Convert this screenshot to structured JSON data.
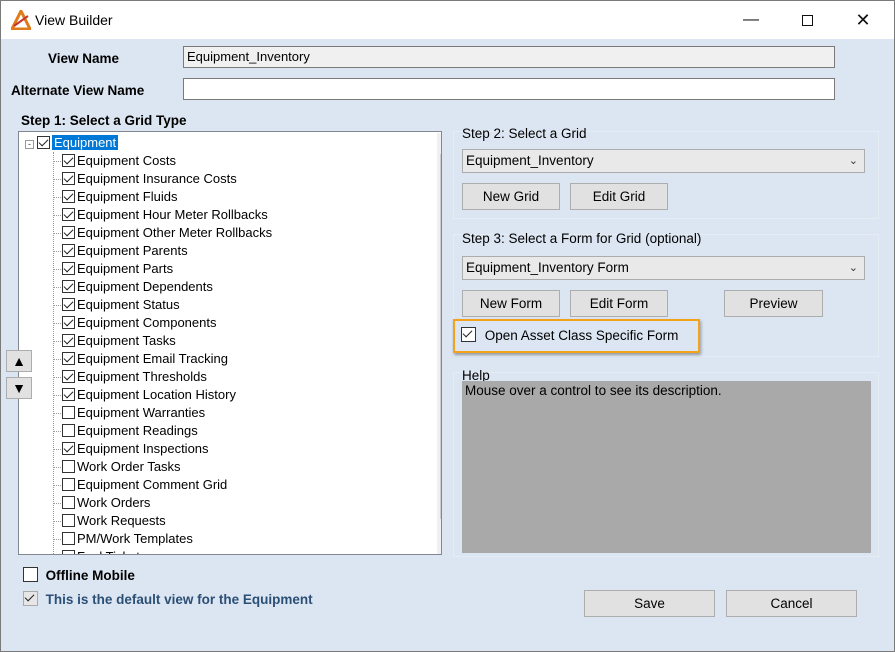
{
  "window": {
    "title": "View Builder"
  },
  "view_name": {
    "label": "View Name",
    "value": "Equipment_Inventory"
  },
  "alt_view_name": {
    "label": "Alternate View Name",
    "value": ""
  },
  "step1": {
    "label": "Step 1: Select a Grid Type",
    "root": {
      "label": "Equipment",
      "checked": true
    },
    "items": [
      {
        "label": "Equipment Costs",
        "checked": true
      },
      {
        "label": "Equipment Insurance Costs",
        "checked": true
      },
      {
        "label": "Equipment Fluids",
        "checked": true
      },
      {
        "label": "Equipment Hour Meter Rollbacks",
        "checked": true
      },
      {
        "label": "Equipment Other Meter Rollbacks",
        "checked": true
      },
      {
        "label": "Equipment Parents",
        "checked": true
      },
      {
        "label": "Equipment Parts",
        "checked": true
      },
      {
        "label": "Equipment Dependents",
        "checked": true
      },
      {
        "label": "Equipment Status",
        "checked": true
      },
      {
        "label": "Equipment Components",
        "checked": true
      },
      {
        "label": "Equipment Tasks",
        "checked": true
      },
      {
        "label": "Equipment Email Tracking",
        "checked": true
      },
      {
        "label": "Equipment Thresholds",
        "checked": true
      },
      {
        "label": "Equipment Location History",
        "checked": true
      },
      {
        "label": "Equipment Warranties",
        "checked": false
      },
      {
        "label": "Equipment Readings",
        "checked": false
      },
      {
        "label": "Equipment Inspections",
        "checked": true
      },
      {
        "label": "Work Order Tasks",
        "checked": false
      },
      {
        "label": "Equipment Comment Grid",
        "checked": false
      },
      {
        "label": "Work Orders",
        "checked": false
      },
      {
        "label": "Work Requests",
        "checked": false
      },
      {
        "label": "PM/Work Templates",
        "checked": false
      },
      {
        "label": "Fuel Ticket",
        "checked": false
      }
    ]
  },
  "step2": {
    "label": "Step 2: Select a Grid",
    "selected": "Equipment_Inventory",
    "new_grid": "New Grid",
    "edit_grid": "Edit Grid"
  },
  "step3": {
    "label": "Step 3: Select a Form for Grid (optional)",
    "selected": "Equipment_Inventory Form",
    "new_form": "New Form",
    "edit_form": "Edit Form",
    "preview": "Preview",
    "asset_class_label": "Open Asset Class Specific Form",
    "asset_class_checked": true
  },
  "help": {
    "label": "Help",
    "text": "Mouse over a control to see its description."
  },
  "offline_mobile": {
    "label": "Offline Mobile",
    "checked": false
  },
  "default_view": {
    "label": "This is the default view for the Equipment",
    "checked": true
  },
  "buttons": {
    "save": "Save",
    "cancel": "Cancel"
  },
  "colors": {
    "highlight": "#f5a21b",
    "selection": "#0078d7",
    "help_bg": "#a9a9a9"
  }
}
